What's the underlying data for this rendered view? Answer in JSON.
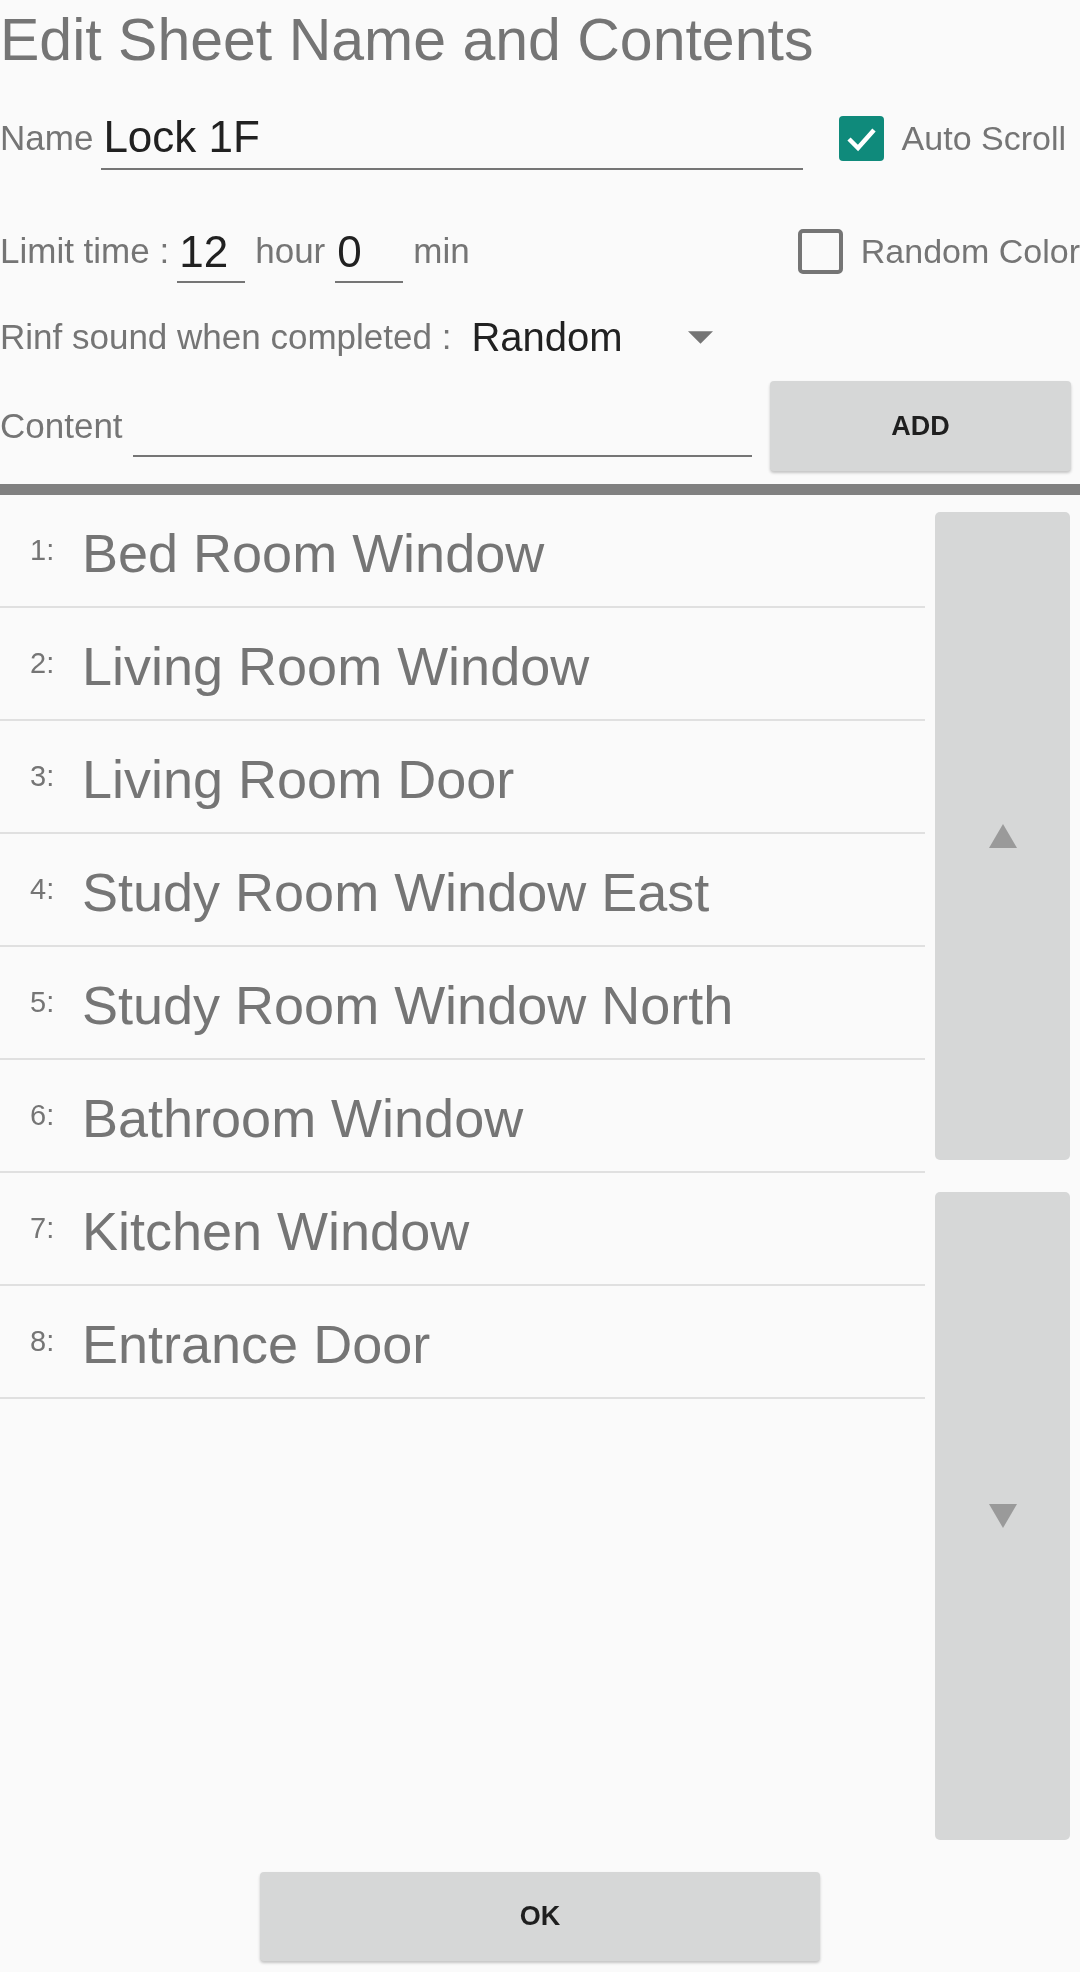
{
  "title": "Edit Sheet Name and Contents",
  "name_field": {
    "label": "Name",
    "value": "Lock 1F"
  },
  "auto_scroll": {
    "label": "Auto Scroll",
    "checked": true
  },
  "limit_time": {
    "label": "Limit time :",
    "hours": "12",
    "hours_unit": "hour",
    "minutes": "0",
    "minutes_unit": "min"
  },
  "random_color": {
    "label": "Random Color",
    "checked": false
  },
  "sound": {
    "label": "Rinf sound when completed :",
    "value": "Random"
  },
  "content_field": {
    "label": "Content"
  },
  "add_button": "ADD",
  "items": [
    {
      "number": "1:",
      "text": "Bed Room Window"
    },
    {
      "number": "2:",
      "text": "Living Room Window"
    },
    {
      "number": "3:",
      "text": "Living Room Door"
    },
    {
      "number": "4:",
      "text": "Study Room Window East"
    },
    {
      "number": "5:",
      "text": "Study Room Window North"
    },
    {
      "number": "6:",
      "text": "Bathroom Window"
    },
    {
      "number": "7:",
      "text": "Kitchen Window"
    },
    {
      "number": "8:",
      "text": "Entrance Door"
    }
  ],
  "ok_button": "OK"
}
